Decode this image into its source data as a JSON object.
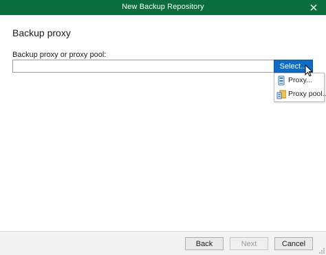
{
  "window": {
    "title": "New Backup Repository",
    "accent_color": "#0a6e3f",
    "close_icon": "close-icon"
  },
  "page": {
    "heading": "Backup proxy",
    "field_label": "Backup proxy or proxy pool:",
    "proxy_input": {
      "value": "",
      "placeholder": ""
    },
    "select_button_label": "Select...",
    "select_button_color": "#0e6cc4"
  },
  "menu": {
    "items": [
      {
        "label": "Proxy...",
        "icon": "proxy-server-icon"
      },
      {
        "label": "Proxy pool...",
        "icon": "proxy-pool-icon"
      }
    ]
  },
  "footer": {
    "back_label": "Back",
    "next_label": "Next",
    "cancel_label": "Cancel"
  }
}
